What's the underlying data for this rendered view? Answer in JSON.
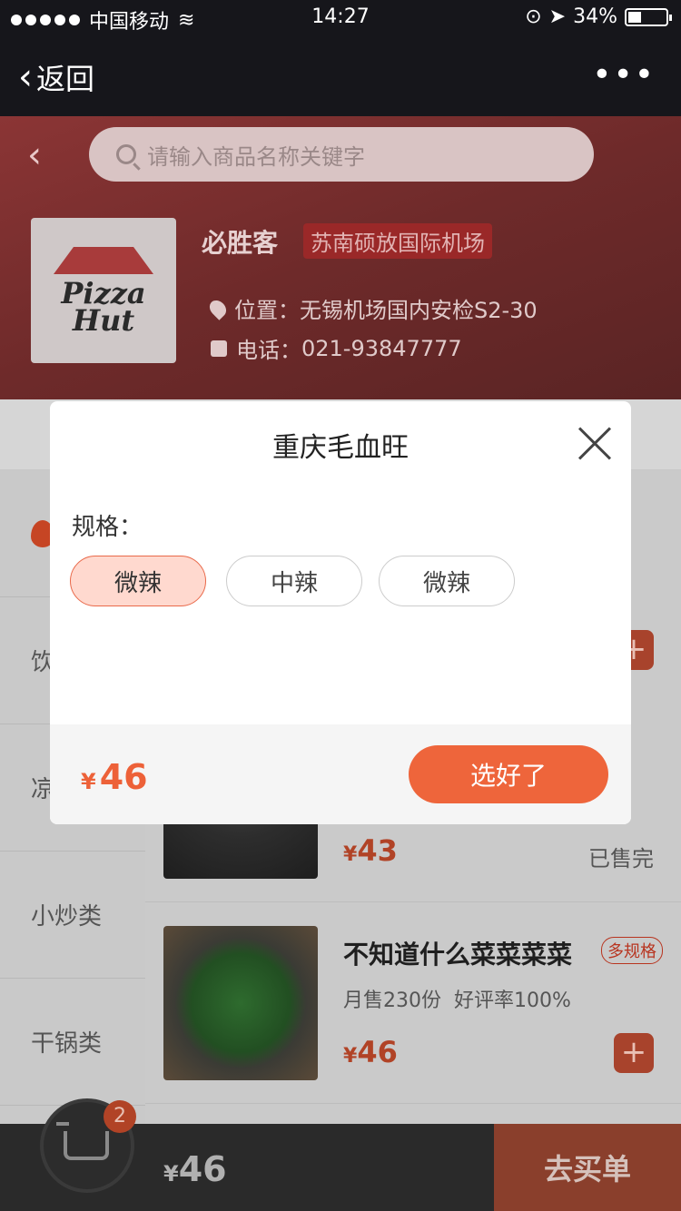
{
  "status": {
    "carrier": "中国移动",
    "time": "14:27",
    "battery": "34%"
  },
  "nav": {
    "back_label": "返回",
    "more_label": "•••"
  },
  "search": {
    "placeholder": "请输入商品名称关键字"
  },
  "store": {
    "name": "必胜客",
    "branch": "苏南硕放国际机场",
    "logo_text_1": "Pizza",
    "logo_text_2": "Hut",
    "location_label": "位置：",
    "location": "无锡机场国内安检S2-30",
    "phone_label": "电话：",
    "phone": "021-93847777"
  },
  "sidebar": {
    "items": [
      {
        "label": ""
      },
      {
        "label": "饮"
      },
      {
        "label": "凉"
      },
      {
        "label": "小炒类"
      },
      {
        "label": "干锅类"
      }
    ]
  },
  "products": [
    {
      "price_symbol": "¥",
      "price": "43",
      "status": "已售完"
    },
    {
      "name": "不知道什么菜菜菜菜",
      "badge": "多规格",
      "sales": "月售230份",
      "rating": "好评率100%",
      "price_symbol": "¥",
      "price": "46",
      "add": "+"
    }
  ],
  "cart": {
    "count": "2",
    "price_symbol": "¥",
    "price": "46",
    "checkout_label": "去买单"
  },
  "modal": {
    "title": "重庆毛血旺",
    "spec_label": "规格：",
    "options": [
      {
        "label": "微辣",
        "selected": true
      },
      {
        "label": "中辣"
      },
      {
        "label": "微辣"
      }
    ],
    "price_symbol": "¥",
    "price": "46",
    "confirm_label": "选好了"
  },
  "colors": {
    "accent": "#ee653b",
    "header": "#16161b",
    "selected_option_bg": "#ffd9cf"
  }
}
